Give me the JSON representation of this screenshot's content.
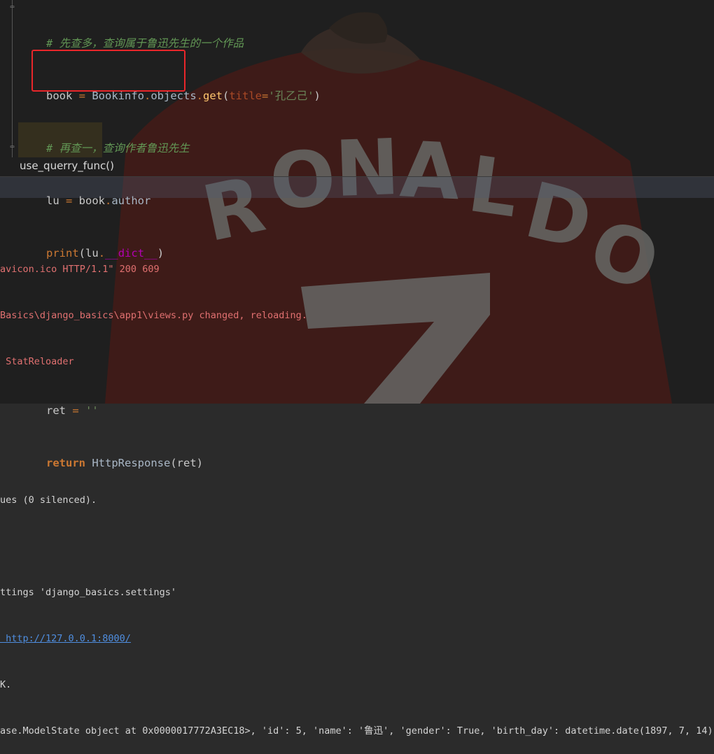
{
  "editor": {
    "lines": {
      "comment1": "# 先查多，查询属于鲁迅先生的一个作品",
      "book_var": "book",
      "eq": " = ",
      "book_cls": "Bookinfo",
      "dot": ".",
      "objects": "objects",
      "get_fn": "get",
      "paren_open": "(",
      "title_param": "title",
      "assign": "=",
      "title_val": "'孔乙己'",
      "paren_close": ")",
      "comment2": "# 再查一，查询作者鲁迅先生",
      "lu_var": "lu",
      "author_attr": "author",
      "print_fn": "print",
      "dict_attr": "__dict__",
      "ret_var": "ret",
      "ret_val": "''",
      "return_kw": "return",
      "http_resp": "HttpResponse",
      "ret_arg": "ret"
    },
    "breadcrumb": "use_querry_func()"
  },
  "console": {
    "lines": [
      {
        "text": "avicon.ico HTTP/1.1\" 200 609",
        "color": "red"
      },
      {
        "text": "Basics\\django_basics\\app1\\views.py changed, reloading.",
        "color": "red"
      },
      {
        "text": " StatReloader",
        "color": "red"
      },
      {
        "text": "",
        "color": "white"
      },
      {
        "text": "",
        "color": "white"
      },
      {
        "text": "ues (0 silenced).",
        "color": "white"
      },
      {
        "text": "",
        "color": "white"
      },
      {
        "text": "ttings 'django_basics.settings'",
        "color": "white"
      },
      {
        "text": " http://127.0.0.1:8000/",
        "color": "link"
      },
      {
        "text": "K.",
        "color": "white"
      },
      {
        "text": "ase.ModelState object at 0x0000017772A3EC18>, 'id': 5, 'name': '鲁迅', 'gender': True, 'birth_day': datetime.date(1897, 7, 14)}",
        "color": "white"
      }
    ]
  },
  "colors": {
    "highlight_box": "#e8262a",
    "comment": "#629755",
    "keyword": "#cc7832",
    "link": "#4f8ee0"
  }
}
